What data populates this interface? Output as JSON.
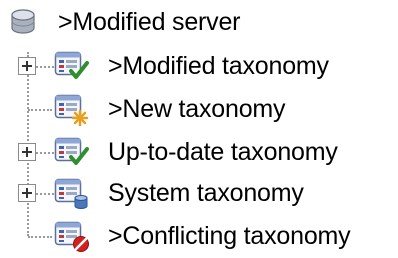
{
  "tree": {
    "root": {
      "label": ">Modified server",
      "icon": "server-icon"
    },
    "items": [
      {
        "label": ">Modified taxonomy",
        "icon": "taxonomy-checked-icon",
        "expandable": true
      },
      {
        "label": ">New taxonomy",
        "icon": "taxonomy-new-icon",
        "expandable": false
      },
      {
        "label": "Up-to-date taxonomy",
        "icon": "taxonomy-checked-icon",
        "expandable": true
      },
      {
        "label": "System taxonomy",
        "icon": "taxonomy-system-icon",
        "expandable": true
      },
      {
        "label": ">Conflicting taxonomy",
        "icon": "taxonomy-conflict-icon",
        "expandable": false
      }
    ]
  },
  "colors": {
    "guide_line": "#9a9a9a",
    "check_green": "#2f8f2f",
    "new_star": "#e8a020",
    "conflict_red": "#d42020",
    "system_blue": "#4a78b8"
  }
}
